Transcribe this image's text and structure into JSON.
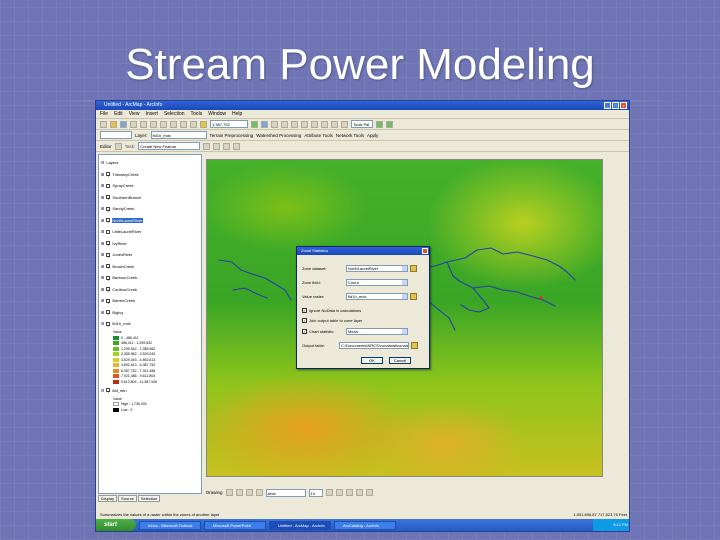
{
  "slide": {
    "title": "Stream Power Modeling"
  },
  "window": {
    "title": "Untitled - ArcMap - ArcInfo"
  },
  "menu": [
    "File",
    "Edit",
    "View",
    "Insert",
    "Selection",
    "Tools",
    "Window",
    "Help"
  ],
  "toolbar1": {
    "scale": "1:387,752",
    "tools_label": "Tools Pal"
  },
  "toolbar2": {
    "layer_label": "Layer:",
    "layer_value": "fld1h_mdx",
    "menus": [
      "Terrain Preprocessing",
      "Watershed Processing",
      "Attribute Tools",
      "Network Tools",
      "Apply"
    ]
  },
  "toolbar3": {
    "editor_label": "Editor",
    "task_value": "Create New Feature"
  },
  "toc": {
    "root": "Layers",
    "layers": [
      "TributaryCreek",
      "SprayCreek",
      "SouthernBranch",
      "SandyCreek",
      "NorthLaurelRiver",
      "LittleLaurelRiver",
      "IvyRiver",
      "JonesRiver",
      "BrownCreek",
      "BarbourCreek",
      "CaribouCreek",
      "BarrenCreek",
      "BigIvy",
      "fld1h_mdx"
    ],
    "legend_title": "Value",
    "legend": [
      {
        "label": "0 - 486,411",
        "color": "#1a8f2a"
      },
      {
        "label": "486,411 - 1,299,542",
        "color": "#3aa626"
      },
      {
        "label": "1,299,542 - 2,355,962",
        "color": "#6cbf23"
      },
      {
        "label": "2,355,962 - 3,529,043",
        "color": "#a5cf22"
      },
      {
        "label": "3,529,043 - 4,892,613",
        "color": "#d4d028"
      },
      {
        "label": "4,892,613 - 6,387,752",
        "color": "#e8b52a"
      },
      {
        "label": "6,387,752 - 7,921,486",
        "color": "#e88a24"
      },
      {
        "label": "7,921,486 - 9,612,804",
        "color": "#d85a1c"
      },
      {
        "label": "9,612,804 - 11,387,946",
        "color": "#c02a16"
      }
    ],
    "dem_layer": "flat_mtn",
    "dem_value_title": "Value",
    "dem_high": "High : 1,735,000",
    "dem_low": "Low : 0",
    "tabs": [
      "Display",
      "Source",
      "Selection"
    ]
  },
  "dialog": {
    "title": "Zonal Statistics",
    "zone_dataset_label": "Zone dataset:",
    "zone_dataset_value": "NorthLaurelRiver",
    "zone_field_label": "Zone field:",
    "zone_field_value": "Count",
    "value_raster_label": "Value raster:",
    "value_raster_value": "fld1h_mdx",
    "ignore_nodata": "Ignore NoData in calculations",
    "join_output": "Join output table to zone layer",
    "chart_stat_label": "Chart statistic:",
    "chart_stat_value": "Mean",
    "output_table_label": "Output table:",
    "output_table_value": "C:\\Documents\\NRCS\\zonalstat\\zonalst.dbf",
    "ok": "OK",
    "cancel": "Cancel"
  },
  "statusbar": {
    "drawing": "Drawing",
    "font": "Arial",
    "font_size": "10",
    "left_msg": "Summarizes the values of a raster within the zones of another layer",
    "coords": "1,051,896.87  717,523.76 Feet"
  },
  "taskbar": {
    "start": "start",
    "tasks": [
      "Inbox - Microsoft Outlook",
      "Microsoft PowerPoint",
      "Untitled - ArcMap - ArcInfo",
      "ArcCatalog - ArcInfo"
    ],
    "time": "3:12 PM"
  }
}
